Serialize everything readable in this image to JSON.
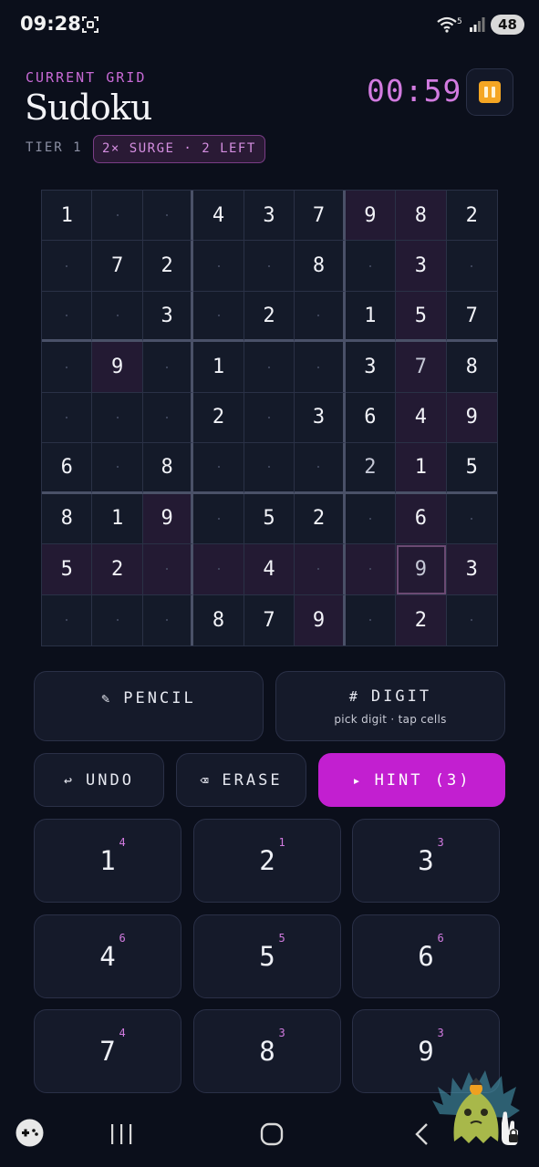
{
  "status": {
    "time": "09:28",
    "wifi_label": "5",
    "battery": "48"
  },
  "header": {
    "eyebrow": "CURRENT GRID",
    "title": "Sudoku",
    "tier": "TIER 1",
    "surge": "2× SURGE · 2 LEFT",
    "timer": "00:59"
  },
  "grid": {
    "rows": [
      [
        "1",
        "",
        "",
        "4",
        "3",
        "7",
        "9",
        "8",
        "2"
      ],
      [
        "",
        "7",
        "2",
        "",
        "",
        "8",
        "",
        "3",
        ""
      ],
      [
        "",
        "",
        "3",
        "",
        "2",
        "",
        "1",
        "5",
        "7"
      ],
      [
        "",
        "9",
        "",
        "1",
        "",
        "",
        "3",
        "7",
        "8"
      ],
      [
        "",
        "",
        "",
        "2",
        "",
        "3",
        "6",
        "4",
        "9"
      ],
      [
        "6",
        "",
        "8",
        "",
        "",
        "",
        "2",
        "1",
        "5"
      ],
      [
        "8",
        "1",
        "9",
        "",
        "5",
        "2",
        "",
        "6",
        ""
      ],
      [
        "5",
        "2",
        "",
        "",
        "4",
        "",
        "",
        "9",
        "3"
      ],
      [
        "",
        "",
        "",
        "8",
        "7",
        "9",
        "",
        "2",
        ""
      ]
    ],
    "user_entries": [
      [
        3,
        7
      ],
      [
        5,
        6
      ],
      [
        7,
        7
      ]
    ],
    "highlighted": [
      [
        0,
        6
      ],
      [
        0,
        7
      ],
      [
        1,
        7
      ],
      [
        2,
        7
      ],
      [
        3,
        1
      ],
      [
        3,
        7
      ],
      [
        4,
        7
      ],
      [
        4,
        8
      ],
      [
        5,
        7
      ],
      [
        6,
        2
      ],
      [
        6,
        7
      ],
      [
        7,
        0
      ],
      [
        7,
        1
      ],
      [
        7,
        2
      ],
      [
        7,
        3
      ],
      [
        7,
        4
      ],
      [
        7,
        5
      ],
      [
        7,
        6
      ],
      [
        7,
        7
      ],
      [
        7,
        8
      ],
      [
        8,
        5
      ],
      [
        8,
        7
      ]
    ],
    "selected": [
      7,
      7
    ]
  },
  "controls": {
    "pencil": {
      "icon": "pencil-icon",
      "label": "PENCIL"
    },
    "digit": {
      "icon": "hash-icon",
      "label": "DIGIT",
      "sub": "pick digit · tap cells"
    },
    "undo": {
      "icon": "undo-icon",
      "label": "UNDO"
    },
    "erase": {
      "icon": "erase-icon",
      "label": "ERASE"
    },
    "hint": {
      "icon": "play-icon",
      "label": "HINT (3)"
    }
  },
  "keypad": [
    {
      "digit": "1",
      "remaining": "4"
    },
    {
      "digit": "2",
      "remaining": "1"
    },
    {
      "digit": "3",
      "remaining": "3"
    },
    {
      "digit": "4",
      "remaining": "6"
    },
    {
      "digit": "5",
      "remaining": "5"
    },
    {
      "digit": "6",
      "remaining": "6"
    },
    {
      "digit": "7",
      "remaining": "4"
    },
    {
      "digit": "8",
      "remaining": "3"
    },
    {
      "digit": "9",
      "remaining": "3"
    }
  ],
  "colors": {
    "accent": "#c21fd0",
    "accent_text": "#d27be0",
    "background": "#0b0f1b",
    "pause": "#f5a623"
  }
}
